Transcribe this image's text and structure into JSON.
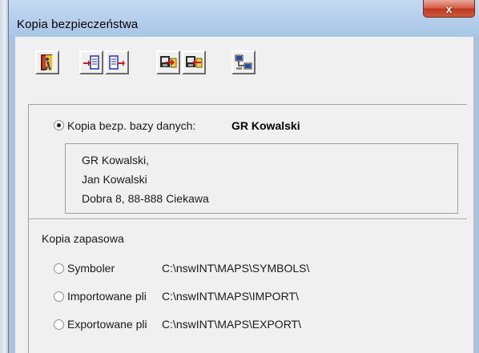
{
  "window": {
    "title": "Kopia bezpieczeństwa",
    "close_label": "x"
  },
  "toolbar": {
    "buttons": [
      {
        "icon": "exit-door-icon"
      },
      {
        "icon": "backup-to-disk-icon"
      },
      {
        "icon": "restore-from-disk-icon"
      },
      {
        "icon": "export-icon"
      },
      {
        "icon": "import-icon"
      },
      {
        "icon": "network-computers-icon"
      }
    ]
  },
  "database_backup": {
    "selected": true,
    "label": "Kopia bezp. bazy danych:",
    "database_name": "GR Kowalski",
    "address_lines": [
      "GR Kowalski,",
      "Jan Kowalski",
      "Dobra 8, 88-888 Ciekawa"
    ]
  },
  "backup_copy": {
    "heading": "Kopia zapasowa",
    "options": [
      {
        "label": "Symboler",
        "path": "C:\\nswINT\\MAPS\\SYMBOLS\\",
        "selected": false
      },
      {
        "label": "Importowane pli",
        "path": "C:\\nswINT\\MAPS\\IMPORT\\",
        "selected": false
      },
      {
        "label": "Exportowane pli",
        "path": "C:\\nswINT\\MAPS\\EXPORT\\",
        "selected": false
      }
    ]
  },
  "colors": {
    "titlebar": "#b7d0ec",
    "client_bg": "#f0f0f0",
    "close_button": "#c8442b"
  }
}
